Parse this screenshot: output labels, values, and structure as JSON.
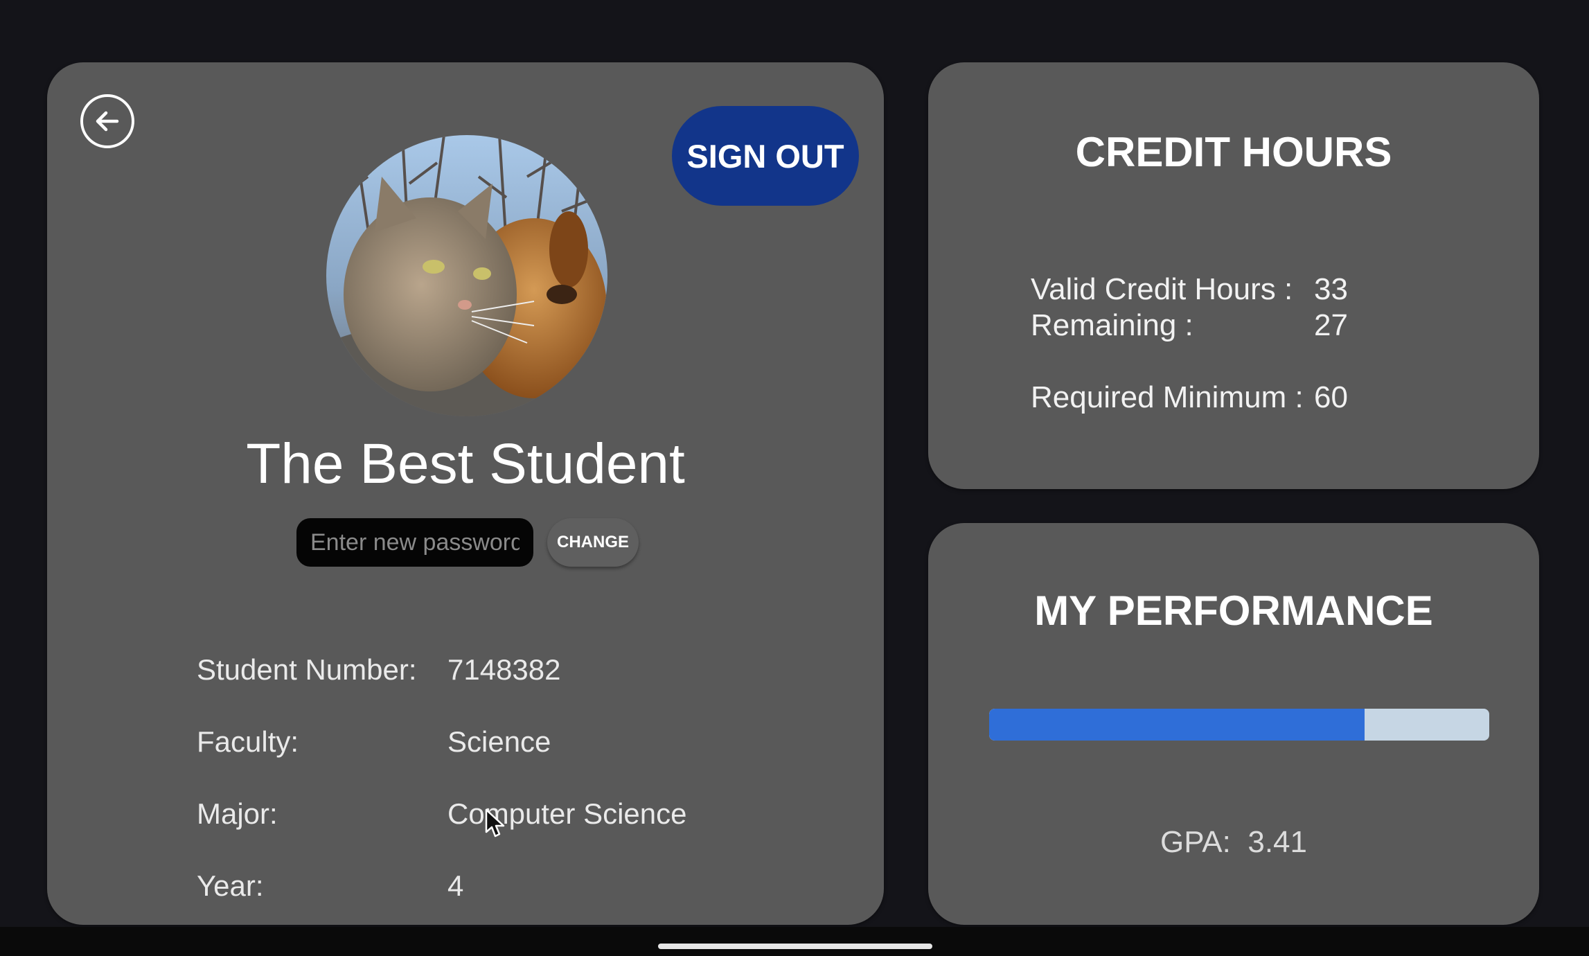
{
  "profile": {
    "back_icon": "arrow-left-circle-icon",
    "sign_out_label": "SIGN OUT",
    "sign_out_color": "#12358a",
    "avatar_icon": "profile-photo-cat-and-dog",
    "name": "The Best Student",
    "password_placeholder": "Enter new password",
    "change_label": "CHANGE",
    "fields": [
      {
        "label": "Student Number:",
        "value": "7148382"
      },
      {
        "label": "Faculty:",
        "value": "Science"
      },
      {
        "label": "Major:",
        "value": "Computer Science"
      },
      {
        "label": "Year:",
        "value": "4"
      }
    ]
  },
  "credit_hours": {
    "title": "CREDIT HOURS",
    "rows": [
      {
        "label": "Valid Credit Hours :",
        "value": "33"
      },
      {
        "label": "Remaining :",
        "value": "27"
      },
      {
        "label": "Required Minimum :",
        "value": "60"
      }
    ]
  },
  "performance": {
    "title": "MY PERFORMANCE",
    "progress_fraction": 0.75,
    "progress_color": "#2f6ed8",
    "track_color": "#c6d6e4",
    "gpa_label": "GPA:",
    "gpa_value": "3.41"
  }
}
